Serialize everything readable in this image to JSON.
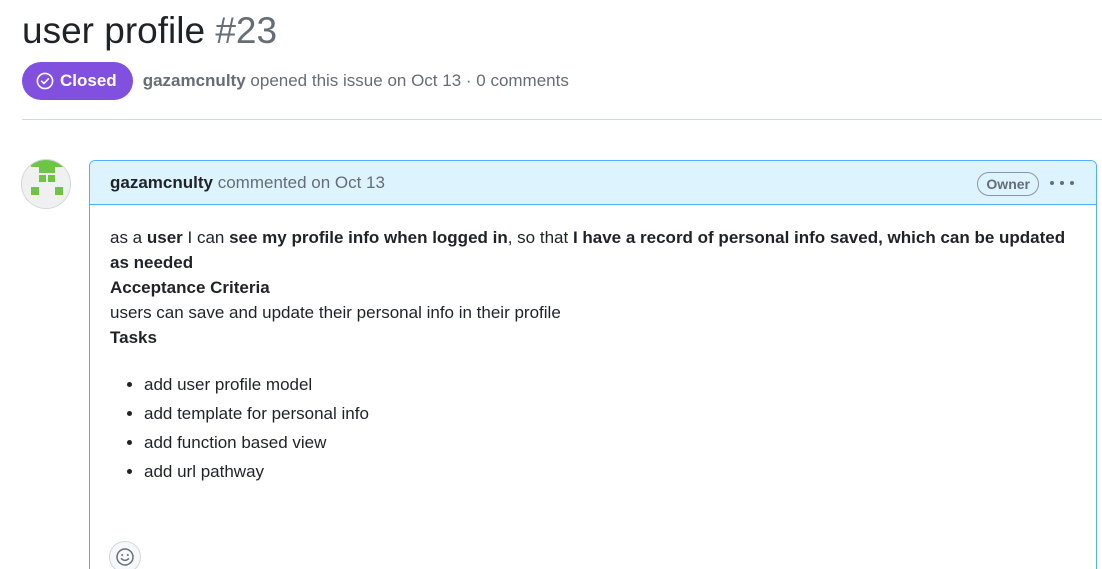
{
  "issue": {
    "title": "user profile",
    "number": "#23",
    "state_label": "Closed",
    "state_color": "#8250df",
    "author": "gazamcnulty",
    "opened_text": "opened this issue on Oct 13 · 0 comments"
  },
  "comment": {
    "author": "gazamcnulty",
    "action_text": "commented on Oct 13",
    "role_badge": "Owner",
    "body": {
      "p1": {
        "t1": "as a ",
        "b1": "user",
        "t2": " I can ",
        "b2": "see my profile info when logged in",
        "t3": ", so that ",
        "b3": "I have a record of personal info saved, which can be updated as needed"
      },
      "acceptance_title": "Acceptance Criteria",
      "acceptance_text": "users can save and update their personal info in their profile",
      "tasks_title": "Tasks",
      "tasks": [
        "add user profile model",
        "add template for personal info",
        "add function based view",
        "add url pathway"
      ]
    }
  },
  "icons": {
    "state": "check-circle-icon",
    "menu": "kebab-horizontal-icon",
    "reaction": "smiley-icon",
    "avatar": "identicon"
  },
  "colors": {
    "header_bg": "#ddf4ff",
    "header_border": "#54aeff",
    "identicon": "#6cc644"
  }
}
